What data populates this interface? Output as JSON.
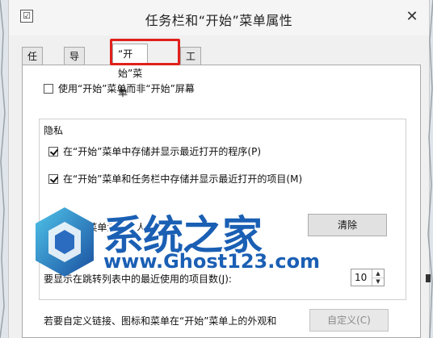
{
  "window": {
    "title": "任务栏和“开始”菜单属性",
    "close_glyph": "✕"
  },
  "tabs": [
    {
      "label": "任务栏",
      "active": false
    },
    {
      "label": "导航",
      "active": false
    },
    {
      "label": "“开始”菜单",
      "active": true
    },
    {
      "label": "工具栏",
      "active": false
    }
  ],
  "options": {
    "use_start_menu": {
      "label": "使用“开始”菜单而非“开始”屏幕",
      "checked": false
    }
  },
  "privacy": {
    "title": "隐私",
    "store_programs": {
      "label": "在“开始”菜单中存储并显示最近打开的程序(P)",
      "checked": true
    },
    "store_items": {
      "label": "在“开始”菜单和任务栏中存储并显示最近打开的项目(M)",
      "checked": true
    },
    "clear_text": "从“开始”菜单清除个人信息。",
    "clear_button": "清除"
  },
  "recent_items": {
    "label": "要显示在跳转列表中的最近使用的项目数(J):",
    "value": "10"
  },
  "customize": {
    "label": "若要自定义链接、图标和菜单在“开始”菜单上的外观和",
    "button": "自定义(C)"
  },
  "watermark": {
    "text_cn": "系统之家",
    "text_url": "www.Ghost123.com"
  },
  "colors": {
    "highlight": "#e0201c",
    "watermark": "#1a5fb4"
  }
}
